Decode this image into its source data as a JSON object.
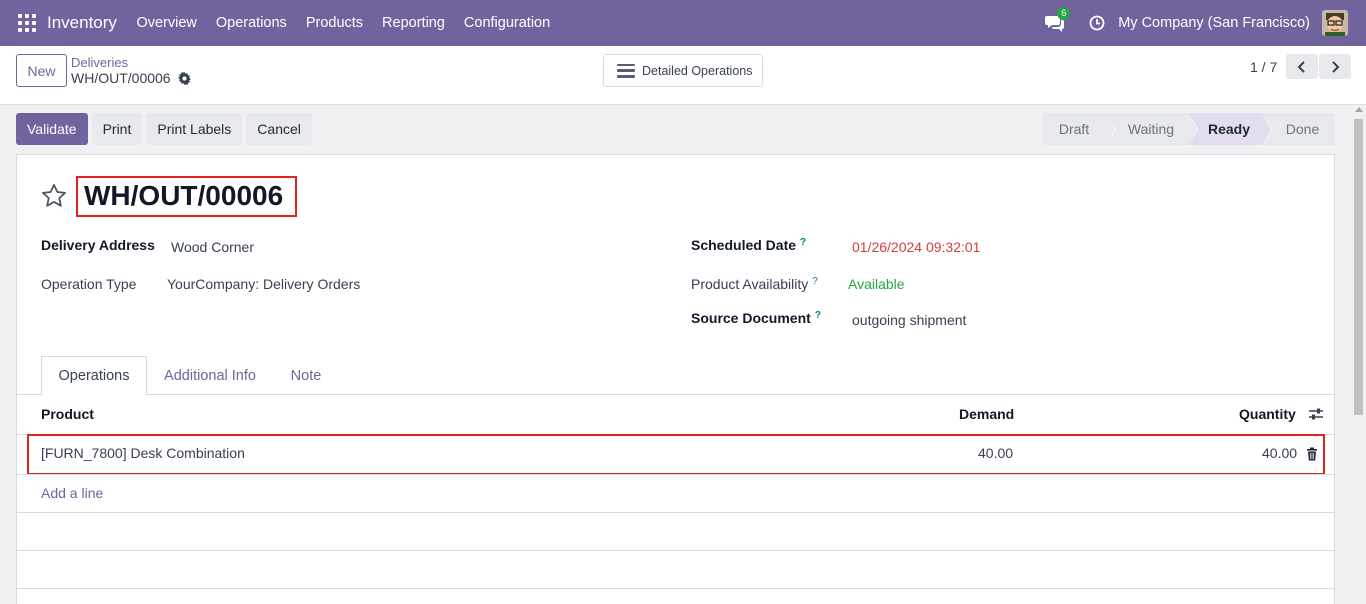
{
  "navbar": {
    "app_name": "Inventory",
    "menu": [
      "Overview",
      "Operations",
      "Products",
      "Reporting",
      "Configuration"
    ],
    "chat_badge": "6",
    "company": "My Company (San Francisco)",
    "colors": {
      "primary": "#71639e",
      "badge": "#28a745"
    }
  },
  "control": {
    "new_label": "New",
    "breadcrumb": "Deliveries",
    "record_name": "WH/OUT/00006",
    "detailed_label": "Detailed Operations",
    "pager": "1 / 7"
  },
  "actions": {
    "validate": "Validate",
    "print": "Print",
    "print_labels": "Print Labels",
    "cancel": "Cancel"
  },
  "statusbar": {
    "states": [
      "Draft",
      "Waiting",
      "Ready",
      "Done"
    ],
    "current": "Ready"
  },
  "form": {
    "title": "WH/OUT/00006",
    "delivery_address_label": "Delivery Address",
    "delivery_address": "Wood Corner",
    "operation_type_label": "Operation Type",
    "operation_type": "YourCompany: Delivery Orders",
    "scheduled_date_label": "Scheduled Date",
    "scheduled_date": "01/26/2024 09:32:01",
    "availability_label": "Product Availability",
    "availability": "Available",
    "source_document_label": "Source Document",
    "source_document": "outgoing shipment",
    "help_mark": "?",
    "colors": {
      "date": "#d23f3a",
      "available": "#28a745",
      "highlight": "#e02424"
    }
  },
  "tabs": [
    "Operations",
    "Additional Info",
    "Note"
  ],
  "table": {
    "headers": {
      "product": "Product",
      "demand": "Demand",
      "quantity": "Quantity"
    },
    "rows": [
      {
        "product": "[FURN_7800] Desk Combination",
        "demand": "40.00",
        "quantity": "40.00"
      }
    ],
    "add_line": "Add a line"
  }
}
